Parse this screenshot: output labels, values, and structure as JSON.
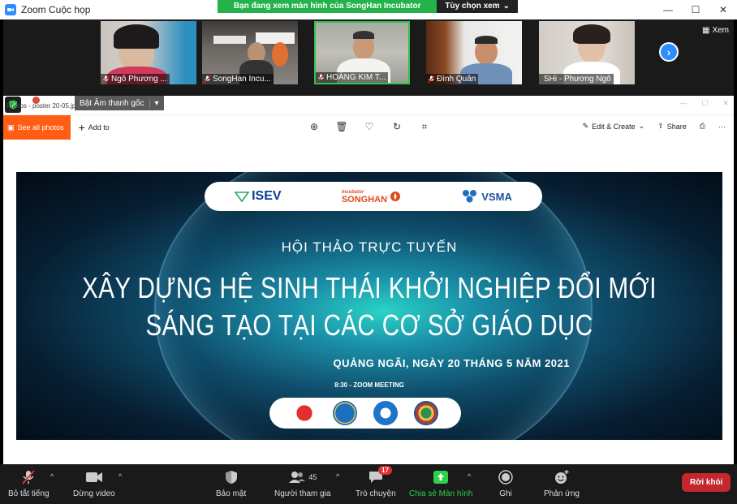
{
  "window": {
    "title": "Zoom Cuộc họp"
  },
  "share_banner": {
    "message": "Bạn đang xem màn hình của SongHan Incubator",
    "view_options": "Tùy chọn xem"
  },
  "gallery": {
    "participants": [
      {
        "name": "Ngô Phương ..."
      },
      {
        "name": "SongHan Incu..."
      },
      {
        "name": "HOÀNG KIM T..."
      },
      {
        "name": "Đình Quân"
      },
      {
        "name": "SHi - Phương Ngô"
      }
    ],
    "view_label": "Xem"
  },
  "photos": {
    "file_name": "Photos - poster 20-05.jpg",
    "audio_label": "Bật Âm thanh gốc",
    "toolbar": {
      "see_all": "See all photos",
      "add_to": "Add to",
      "edit_create": "Edit & Create",
      "share": "Share"
    }
  },
  "poster": {
    "logos": [
      "ISEV",
      "SONGHAN",
      "VSMA"
    ],
    "logo_small": "Incubator",
    "subtitle": "HỘI THẢO TRỰC TUYẾN",
    "line1": "XÂY DỰNG HỆ SINH THÁI KHỞI NGHIỆP ĐỔI MỚI",
    "line2": "SÁNG TẠO TẠI CÁC CƠ SỞ GIÁO DỤC",
    "date": "QUẢNG NGÃI, NGÀY 20 THÁNG 5 NĂM 2021",
    "zoom": "8:30 - ZOOM MEETING"
  },
  "bottom_bar": {
    "mute_all": "Bỏ tắt tiếng",
    "stop_video": "Dừng video",
    "security": "Bảo mật",
    "participants": "Người tham gia",
    "participant_count": "45",
    "chat": "Trò chuyện",
    "chat_badge": "17",
    "share_screen": "Chia sẻ Màn hình",
    "record": "Ghi",
    "reactions": "Phản ứng",
    "leave": "Rời khỏi"
  },
  "colors": {
    "zoom_blue": "#2d8cff",
    "share_green": "#24b24b",
    "photos_orange": "#ff5d14",
    "leave_red": "#c4282e"
  }
}
